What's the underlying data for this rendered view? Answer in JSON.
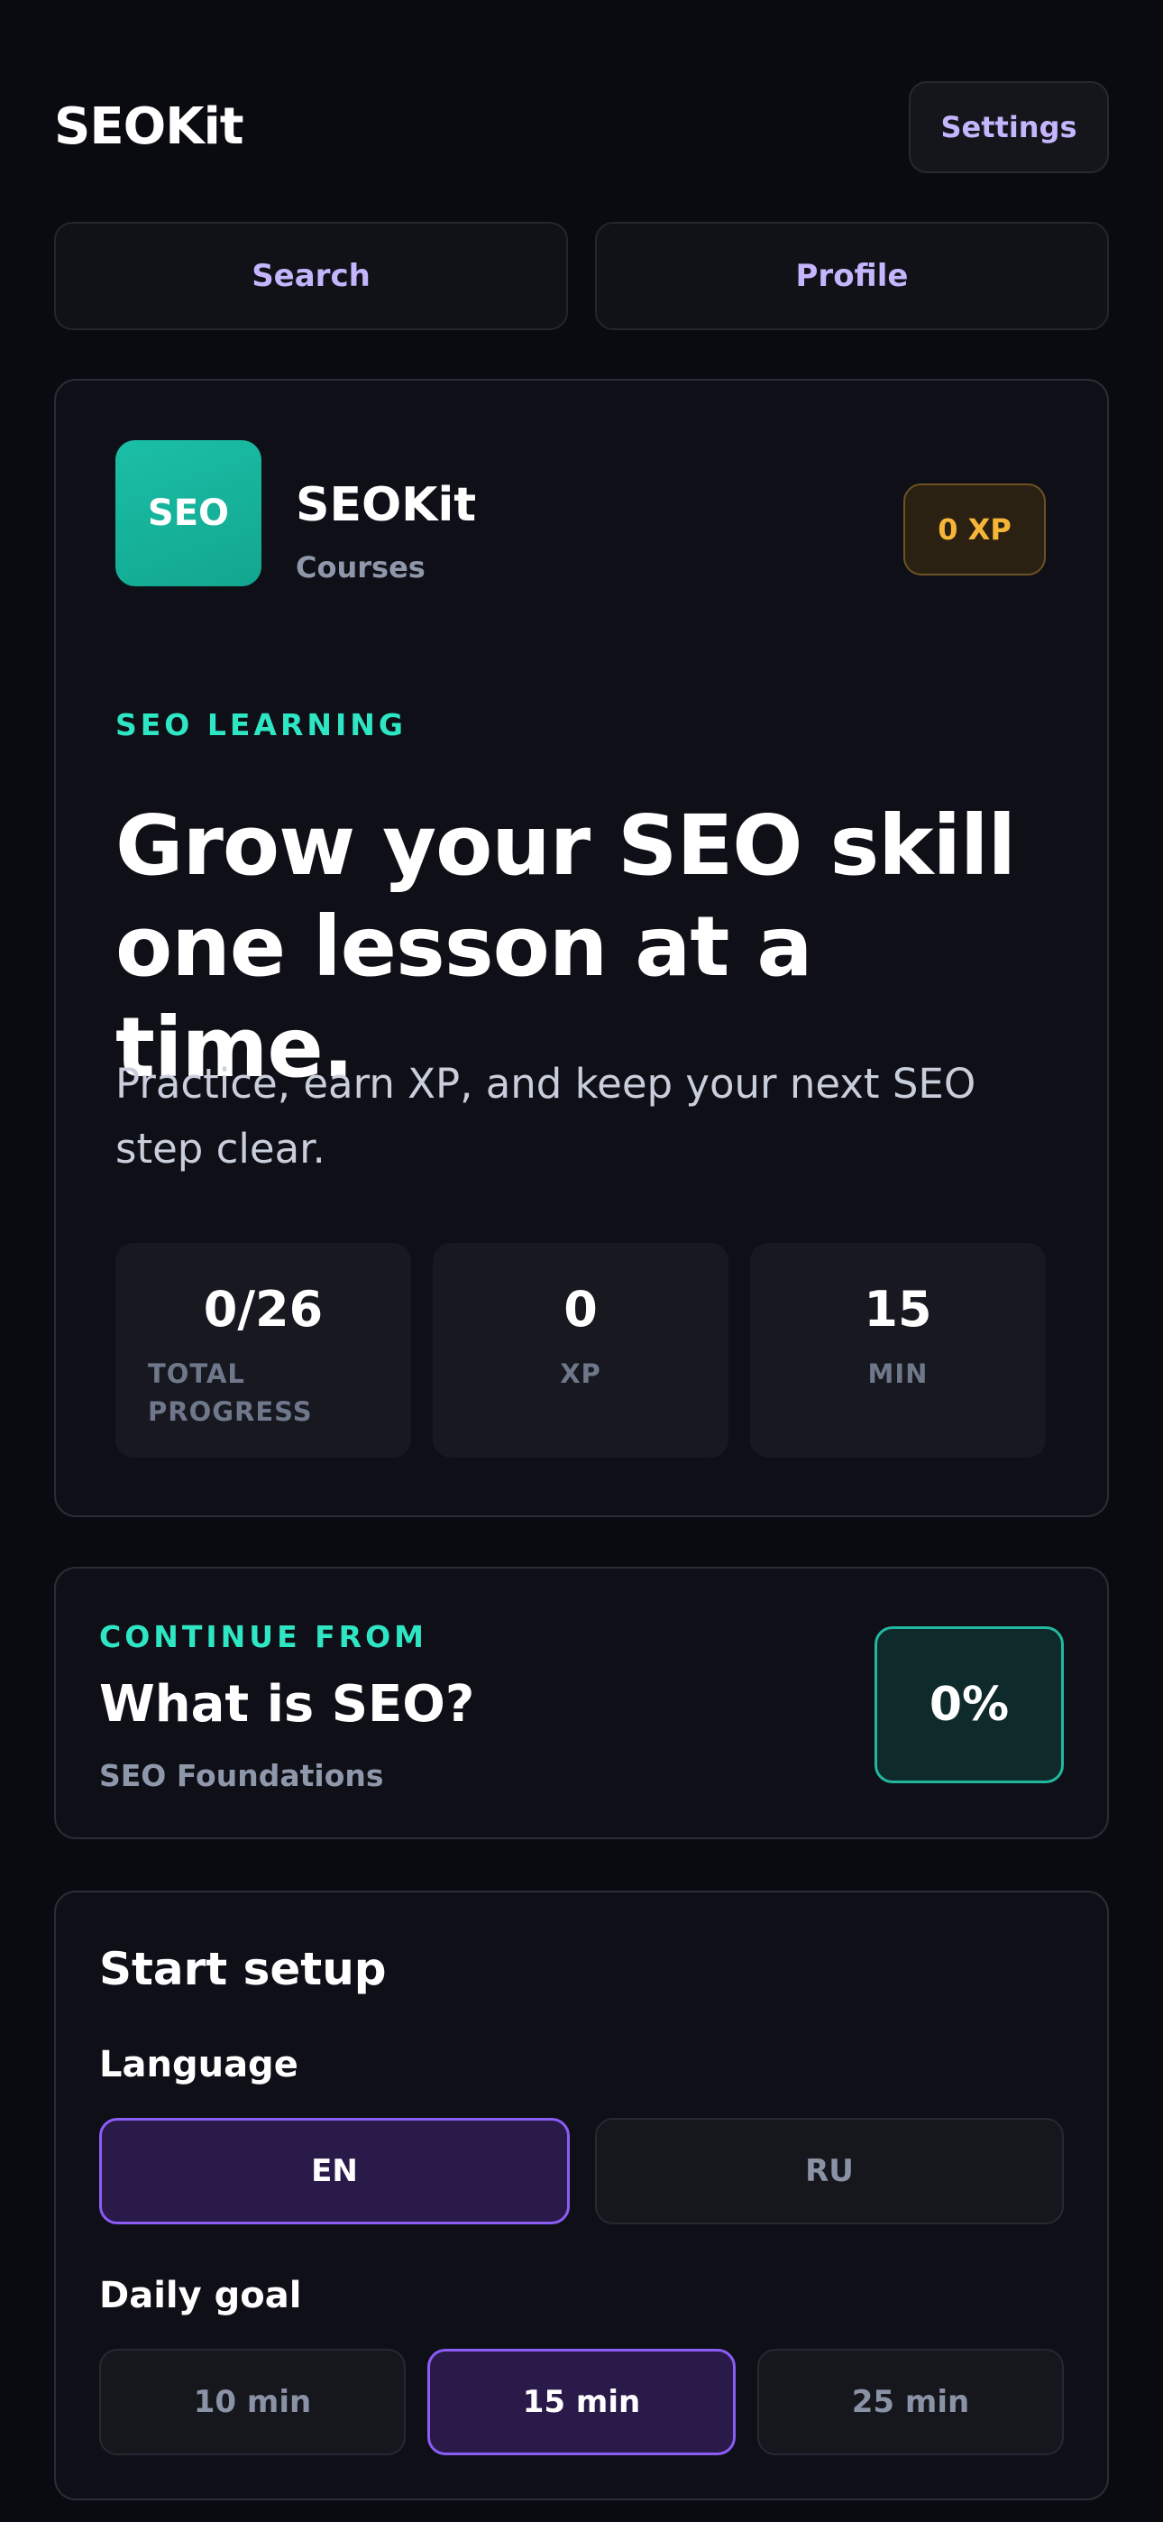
{
  "header": {
    "brand": "SEOKit",
    "settings_label": "Settings"
  },
  "nav": {
    "search_label": "Search",
    "profile_label": "Profile"
  },
  "hero": {
    "logo_text": "SEO",
    "app_name": "SEOKit",
    "app_subtitle": "Courses",
    "xp_badge": "0 XP",
    "eyebrow": "SEO LEARNING",
    "headline": "Grow your SEO skill one lesson at a time.",
    "lede": "Practice, earn XP, and keep your next SEO step clear.",
    "stats": [
      {
        "value": "0/26",
        "label": "TOTAL PROGRESS"
      },
      {
        "value": "0",
        "label": "XP"
      },
      {
        "value": "15",
        "label": "MIN"
      }
    ]
  },
  "continue": {
    "eyebrow": "CONTINUE FROM",
    "title": "What is SEO?",
    "subtitle": "SEO Foundations",
    "progress_label": "0%"
  },
  "setup": {
    "title": "Start setup",
    "language_label": "Language",
    "languages": [
      {
        "label": "EN",
        "selected": true
      },
      {
        "label": "RU",
        "selected": false
      }
    ],
    "goal_label": "Daily goal",
    "goals": [
      {
        "label": "10 min",
        "selected": false
      },
      {
        "label": "15 min",
        "selected": true
      },
      {
        "label": "25 min",
        "selected": false
      }
    ]
  },
  "colors": {
    "background": "#0a0b10",
    "accent_purple": "#c4b5fd",
    "accent_teal": "#2ee6c4",
    "xp_gold": "#f5b638",
    "selected_border": "#8b5cf6"
  }
}
